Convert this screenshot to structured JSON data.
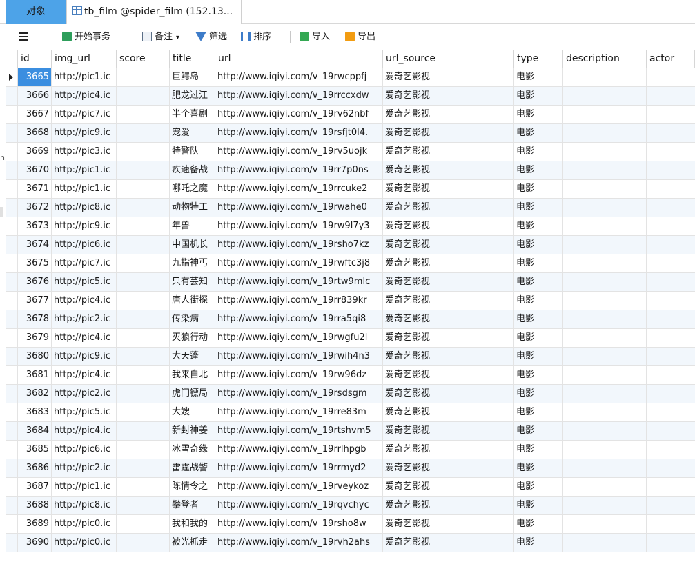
{
  "tabs": {
    "objects": "对象",
    "table_tab": "tb_film @spider_film (152.13..."
  },
  "toolbar": {
    "begin_transaction": "开始事务",
    "memo": "备注",
    "filter": "筛选",
    "sort": "排序",
    "import": "导入",
    "export": "导出"
  },
  "columns": {
    "id": "id",
    "img_url": "img_url",
    "score": "score",
    "title": "title",
    "url": "url",
    "url_source": "url_source",
    "type": "type",
    "description": "description",
    "actor": "actor"
  },
  "rows": [
    {
      "id": "3665",
      "img_url": "http://pic1.ic",
      "score": "",
      "title": "巨鳄岛",
      "url": "http://www.iqiyi.com/v_19rwcppfj",
      "url_source": "爱奇艺影视",
      "type": "电影",
      "description": "",
      "actor": ""
    },
    {
      "id": "3666",
      "img_url": "http://pic4.ic",
      "score": "",
      "title": "肥龙过江",
      "url": "http://www.iqiyi.com/v_19rrccxdw",
      "url_source": "爱奇艺影视",
      "type": "电影",
      "description": "",
      "actor": ""
    },
    {
      "id": "3667",
      "img_url": "http://pic7.ic",
      "score": "",
      "title": "半个喜剧",
      "url": "http://www.iqiyi.com/v_19rv62nbf",
      "url_source": "爱奇艺影视",
      "type": "电影",
      "description": "",
      "actor": ""
    },
    {
      "id": "3668",
      "img_url": "http://pic9.ic",
      "score": "",
      "title": "宠爱",
      "url": "http://www.iqiyi.com/v_19rsfjt0l4.",
      "url_source": "爱奇艺影视",
      "type": "电影",
      "description": "",
      "actor": ""
    },
    {
      "id": "3669",
      "img_url": "http://pic3.ic",
      "score": "",
      "title": "特警队",
      "url": "http://www.iqiyi.com/v_19rv5uojk",
      "url_source": "爱奇艺影视",
      "type": "电影",
      "description": "",
      "actor": ""
    },
    {
      "id": "3670",
      "img_url": "http://pic1.ic",
      "score": "",
      "title": "疾速备战",
      "url": "http://www.iqiyi.com/v_19rr7p0ns",
      "url_source": "爱奇艺影视",
      "type": "电影",
      "description": "",
      "actor": ""
    },
    {
      "id": "3671",
      "img_url": "http://pic1.ic",
      "score": "",
      "title": "哪吒之魔",
      "url": "http://www.iqiyi.com/v_19rrcuke2",
      "url_source": "爱奇艺影视",
      "type": "电影",
      "description": "",
      "actor": ""
    },
    {
      "id": "3672",
      "img_url": "http://pic8.ic",
      "score": "",
      "title": "动物特工",
      "url": "http://www.iqiyi.com/v_19rwahe0",
      "url_source": "爱奇艺影视",
      "type": "电影",
      "description": "",
      "actor": ""
    },
    {
      "id": "3673",
      "img_url": "http://pic9.ic",
      "score": "",
      "title": "年兽",
      "url": "http://www.iqiyi.com/v_19rw9l7y3",
      "url_source": "爱奇艺影视",
      "type": "电影",
      "description": "",
      "actor": ""
    },
    {
      "id": "3674",
      "img_url": "http://pic6.ic",
      "score": "",
      "title": "中国机长",
      "url": "http://www.iqiyi.com/v_19rsho7kz",
      "url_source": "爱奇艺影视",
      "type": "电影",
      "description": "",
      "actor": ""
    },
    {
      "id": "3675",
      "img_url": "http://pic7.ic",
      "score": "",
      "title": "九指神丐",
      "url": "http://www.iqiyi.com/v_19rwftc3j8",
      "url_source": "爱奇艺影视",
      "type": "电影",
      "description": "",
      "actor": ""
    },
    {
      "id": "3676",
      "img_url": "http://pic5.ic",
      "score": "",
      "title": "只有芸知",
      "url": "http://www.iqiyi.com/v_19rtw9mlc",
      "url_source": "爱奇艺影视",
      "type": "电影",
      "description": "",
      "actor": ""
    },
    {
      "id": "3677",
      "img_url": "http://pic4.ic",
      "score": "",
      "title": "唐人街探",
      "url": "http://www.iqiyi.com/v_19rr839kr",
      "url_source": "爱奇艺影视",
      "type": "电影",
      "description": "",
      "actor": ""
    },
    {
      "id": "3678",
      "img_url": "http://pic2.ic",
      "score": "",
      "title": "传染病",
      "url": "http://www.iqiyi.com/v_19rra5qi8",
      "url_source": "爱奇艺影视",
      "type": "电影",
      "description": "",
      "actor": ""
    },
    {
      "id": "3679",
      "img_url": "http://pic4.ic",
      "score": "",
      "title": "灭狼行动",
      "url": "http://www.iqiyi.com/v_19rwgfu2l",
      "url_source": "爱奇艺影视",
      "type": "电影",
      "description": "",
      "actor": ""
    },
    {
      "id": "3680",
      "img_url": "http://pic9.ic",
      "score": "",
      "title": "大天蓬",
      "url": "http://www.iqiyi.com/v_19rwih4n3",
      "url_source": "爱奇艺影视",
      "type": "电影",
      "description": "",
      "actor": ""
    },
    {
      "id": "3681",
      "img_url": "http://pic4.ic",
      "score": "",
      "title": "我来自北",
      "url": "http://www.iqiyi.com/v_19rw96dz",
      "url_source": "爱奇艺影视",
      "type": "电影",
      "description": "",
      "actor": ""
    },
    {
      "id": "3682",
      "img_url": "http://pic2.ic",
      "score": "",
      "title": "虎门镖局",
      "url": "http://www.iqiyi.com/v_19rsdsgm",
      "url_source": "爱奇艺影视",
      "type": "电影",
      "description": "",
      "actor": ""
    },
    {
      "id": "3683",
      "img_url": "http://pic5.ic",
      "score": "",
      "title": "大嫂",
      "url": "http://www.iqiyi.com/v_19rre83m",
      "url_source": "爱奇艺影视",
      "type": "电影",
      "description": "",
      "actor": ""
    },
    {
      "id": "3684",
      "img_url": "http://pic4.ic",
      "score": "",
      "title": "新封神姜",
      "url": "http://www.iqiyi.com/v_19rtshvm5",
      "url_source": "爱奇艺影视",
      "type": "电影",
      "description": "",
      "actor": ""
    },
    {
      "id": "3685",
      "img_url": "http://pic6.ic",
      "score": "",
      "title": "冰雪奇缘",
      "url": "http://www.iqiyi.com/v_19rrlhpgb",
      "url_source": "爱奇艺影视",
      "type": "电影",
      "description": "",
      "actor": ""
    },
    {
      "id": "3686",
      "img_url": "http://pic2.ic",
      "score": "",
      "title": "雷霆战警",
      "url": "http://www.iqiyi.com/v_19rrmyd2",
      "url_source": "爱奇艺影视",
      "type": "电影",
      "description": "",
      "actor": ""
    },
    {
      "id": "3687",
      "img_url": "http://pic1.ic",
      "score": "",
      "title": "陈情令之",
      "url": "http://www.iqiyi.com/v_19rveykoz",
      "url_source": "爱奇艺影视",
      "type": "电影",
      "description": "",
      "actor": ""
    },
    {
      "id": "3688",
      "img_url": "http://pic8.ic",
      "score": "",
      "title": "攀登者",
      "url": "http://www.iqiyi.com/v_19rqvchyc",
      "url_source": "爱奇艺影视",
      "type": "电影",
      "description": "",
      "actor": ""
    },
    {
      "id": "3689",
      "img_url": "http://pic0.ic",
      "score": "",
      "title": "我和我的",
      "url": "http://www.iqiyi.com/v_19rsho8w",
      "url_source": "爱奇艺影视",
      "type": "电影",
      "description": "",
      "actor": ""
    },
    {
      "id": "3690",
      "img_url": "http://pic0.ic",
      "score": "",
      "title": "被光抓走",
      "url": "http://www.iqiyi.com/v_19rvh2ahs",
      "url_source": "爱奇艺影视",
      "type": "电影",
      "description": "",
      "actor": ""
    }
  ],
  "colors": {
    "tab_active": "#4da3e8",
    "selected_cell": "#3b8ee0",
    "alt_row": "#f2f7fc"
  }
}
